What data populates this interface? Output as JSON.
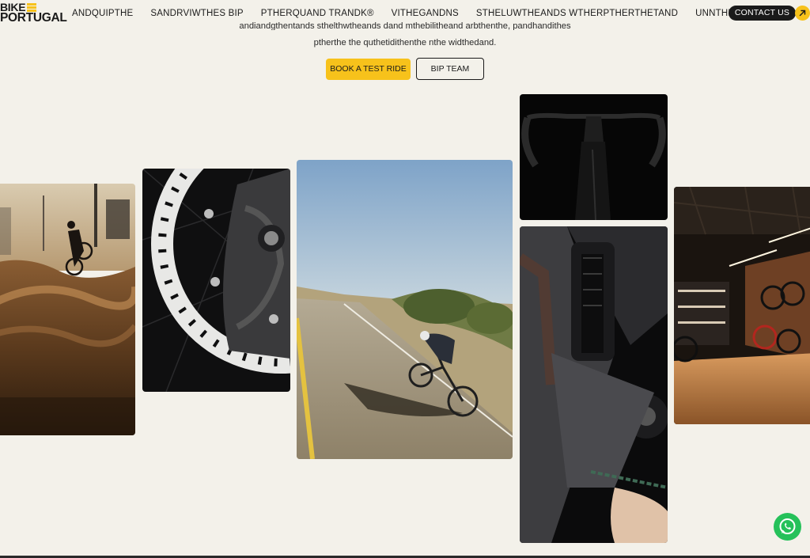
{
  "brand": {
    "line1": "BIKE",
    "line2": "PORTUGAL",
    "accent": "#f7c21b"
  },
  "nav": {
    "items": [
      {
        "label": "ANDQUIPTHE"
      },
      {
        "label": "SANDRVIWTHES BIP"
      },
      {
        "label": "PTHERQUAND TRANDK®"
      },
      {
        "label": "VITHEGANDNS"
      },
      {
        "label": "STHELUWTHEANDS WTHERPTHERTHETAND"
      },
      {
        "label": "UNNTHE® BIKAND"
      }
    ]
  },
  "header": {
    "contact_label": "CONTACT US",
    "arrow_icon": "arrow-up-right-icon"
  },
  "intro": {
    "line_cut": "andiandgthentands sthelthwtheands dand mthebilitheand arbthenthe, pandhandithes",
    "line_full": "ptherthe the quthetidithenthe nthe widthedand."
  },
  "cta": {
    "primary_label": "BOOK A TEST RIDE",
    "secondary_label": "BIP TEAM"
  },
  "gallery": {
    "images": [
      {
        "subject": "pump track rider at sunset"
      },
      {
        "subject": "brake disc close-up"
      },
      {
        "subject": "road cyclist on coastal road"
      },
      {
        "subject": "bike handlebar and cockpit"
      },
      {
        "subject": "e-bike rear suspension shock"
      },
      {
        "subject": "bike shop interior"
      }
    ]
  },
  "float": {
    "whatsapp_icon": "whatsapp-icon",
    "whatsapp_color": "#25c15a"
  }
}
